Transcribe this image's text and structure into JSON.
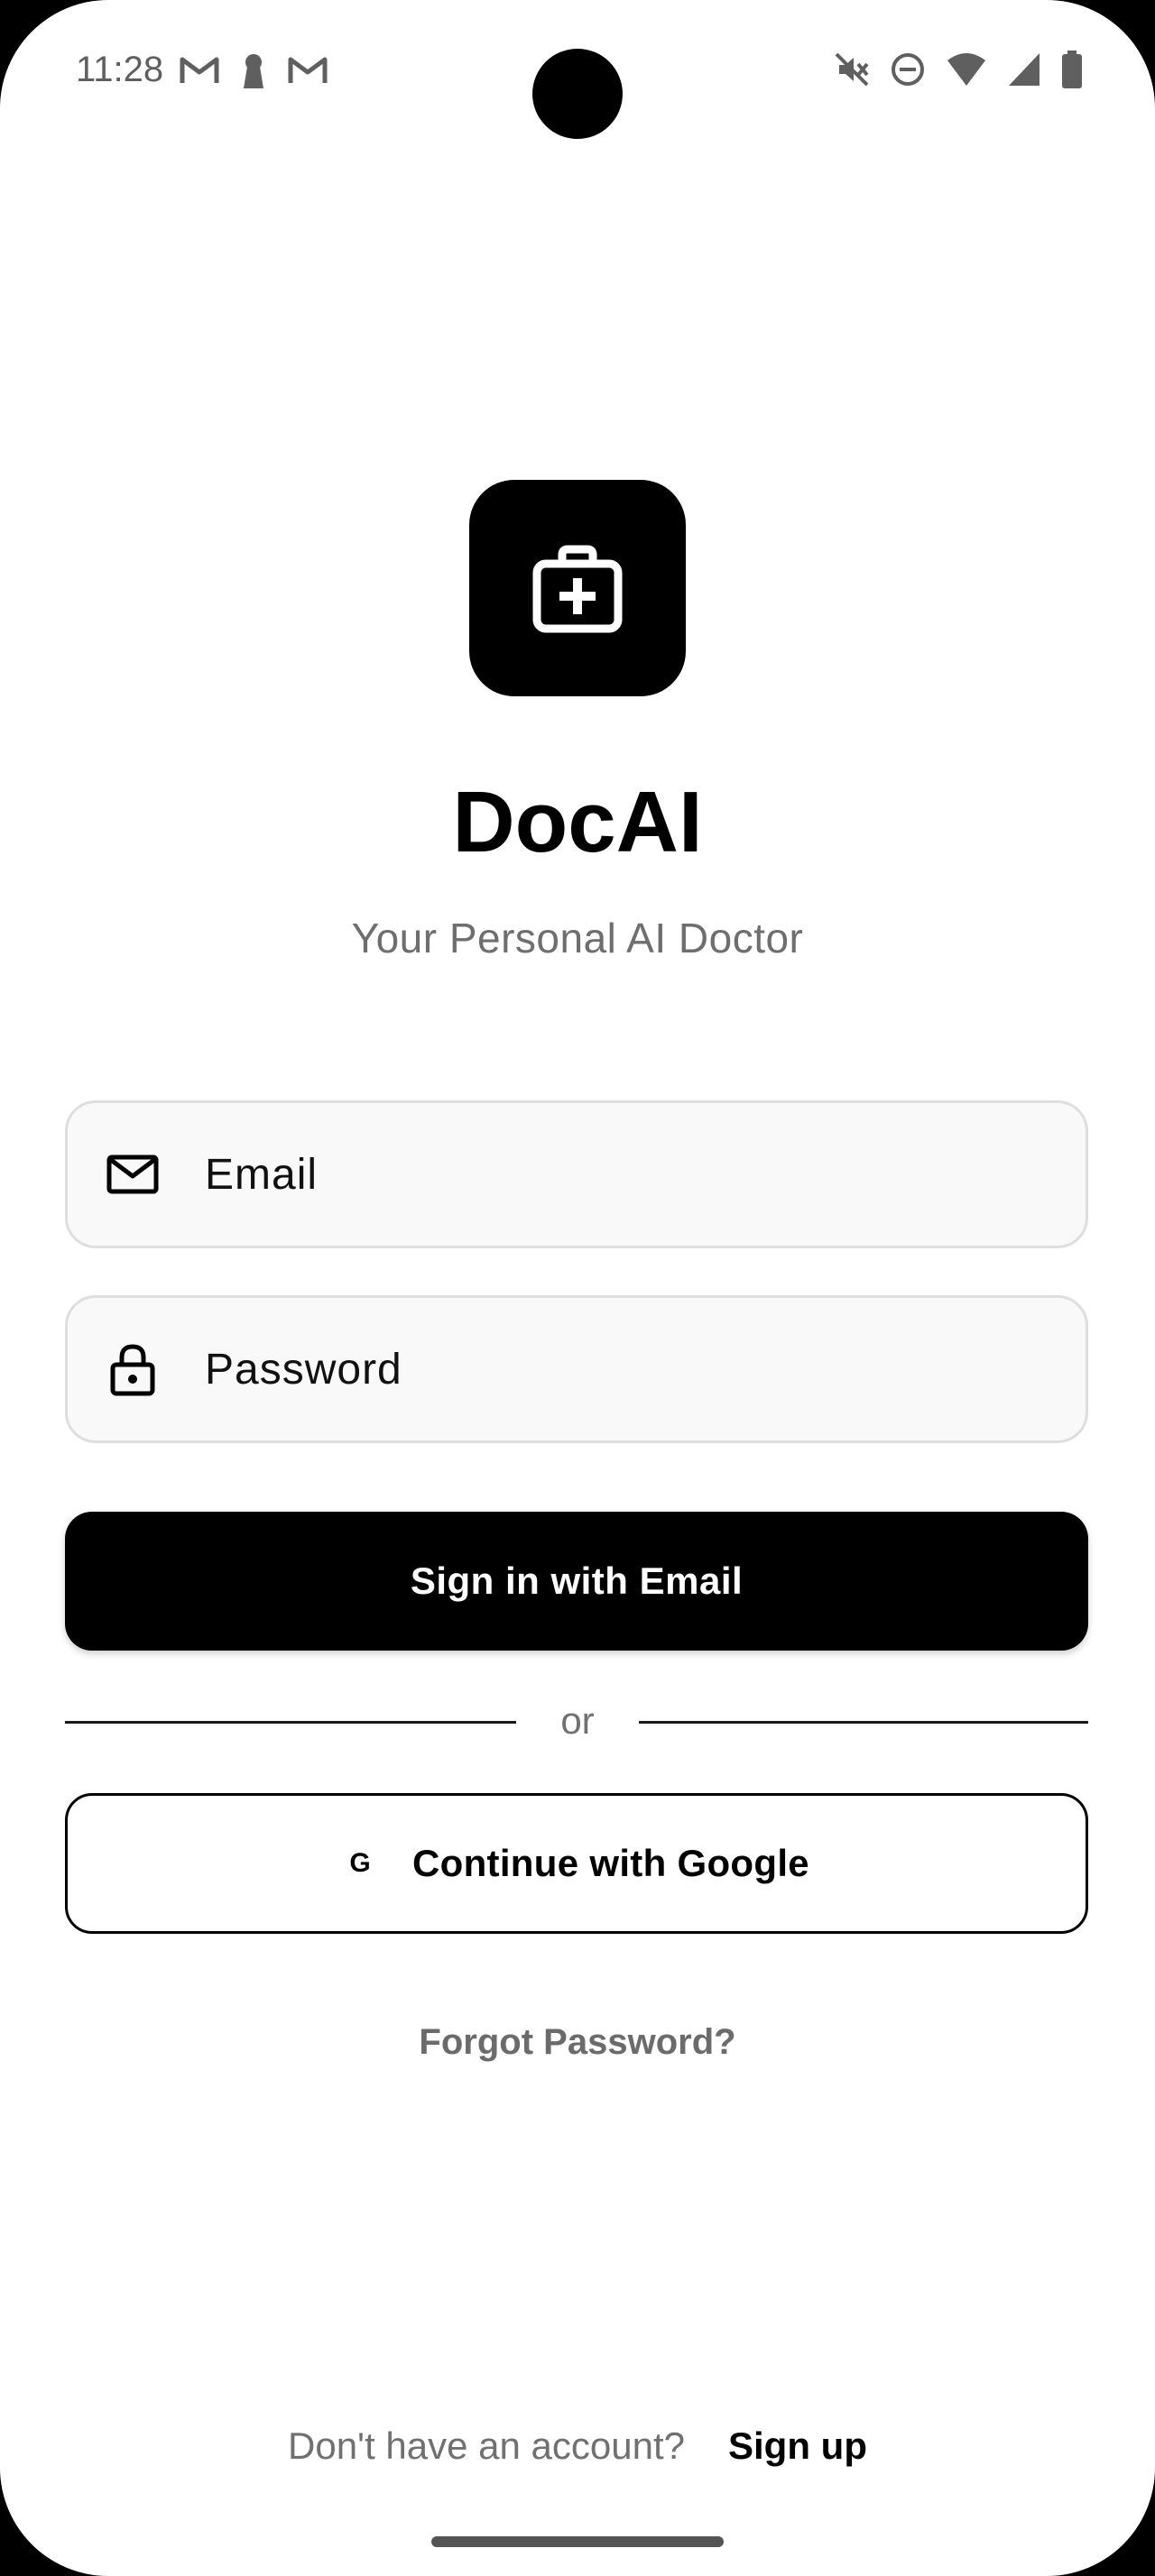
{
  "status_bar": {
    "time": "11:28",
    "left_icons": [
      "gmail-icon",
      "keyhole-icon",
      "gmail-icon"
    ],
    "right_icons": [
      "mute-icon",
      "do-not-disturb-icon",
      "wifi-icon",
      "signal-icon",
      "battery-icon"
    ]
  },
  "app": {
    "logo_icon": "medical-kit-icon",
    "title": "DocAI",
    "subtitle": "Your Personal AI Doctor"
  },
  "form": {
    "email": {
      "icon": "mail-icon",
      "placeholder": "Email",
      "value": ""
    },
    "password": {
      "icon": "lock-icon",
      "placeholder": "Password",
      "value": ""
    },
    "sign_in_label": "Sign in with Email",
    "divider_text": "or",
    "google": {
      "icon_glyph": "G",
      "label": "Continue with Google"
    },
    "forgot_label": "Forgot Password?"
  },
  "footer": {
    "prompt": "Don't have an account?",
    "signup_label": "Sign up"
  },
  "colors": {
    "primary": "#000000",
    "background": "#ffffff",
    "muted_text": "#6e6e6e",
    "field_bg": "#f9f9f9",
    "field_border": "#dedede"
  }
}
